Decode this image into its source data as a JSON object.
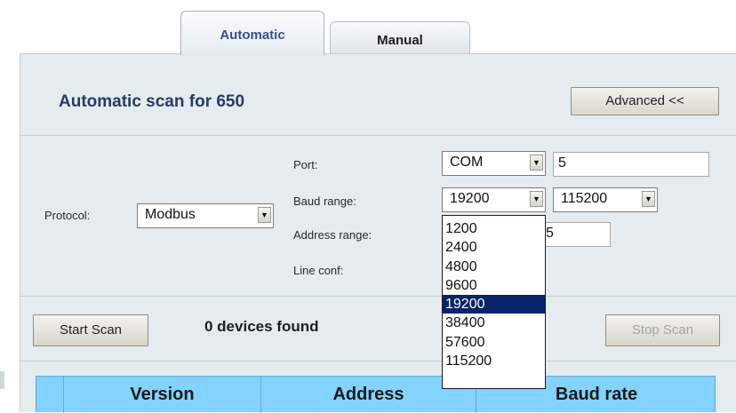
{
  "tabs": [
    {
      "label": "Automatic",
      "active": true
    },
    {
      "label": "Manual",
      "active": false
    }
  ],
  "panel": {
    "title": "Automatic scan for 650",
    "advanced_button": "Advanced <<"
  },
  "form": {
    "protocol_label": "Protocol:",
    "protocol_value": "Modbus",
    "port_label": "Port:",
    "port_type": "COM",
    "port_number": "5",
    "baud_label": "Baud range:",
    "baud_from": "19200",
    "baud_to": "115200",
    "address_label": "Address range:",
    "address_partial": "5",
    "line_label": "Line conf:"
  },
  "baud_dropdown": {
    "options": [
      "1200",
      "2400",
      "4800",
      "9600",
      "19200",
      "38400",
      "57600",
      "115200"
    ],
    "selected": "19200"
  },
  "scan": {
    "start_button": "Start Scan",
    "stop_button": "Stop Scan",
    "devices_found": "0 devices found"
  },
  "table": {
    "columns": [
      "Version",
      "Address",
      "Baud rate"
    ]
  },
  "colors": {
    "panel_bg": "#e4ecf0",
    "title": "#2b3a66",
    "table_header": "#84d2ff",
    "selected_option": "#0b236b"
  }
}
